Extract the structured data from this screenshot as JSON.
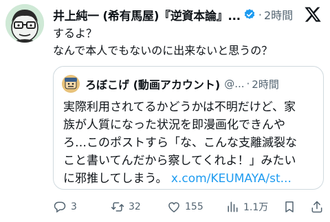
{
  "post": {
    "author_name": "井上純一 (希有馬屋)『逆資本論』...",
    "time": "2時間",
    "lines": [
      "するよ？",
      "なんで本人でもないのに出来ないと思うの？"
    ]
  },
  "quote": {
    "author_name": "ろぼこげ (動画アカウント)",
    "handle": "@...",
    "time": "2時間",
    "lines": [
      "実際利用されてるかどうかは不明だけど、家",
      "族が人質になった状況を即漫画化できんや",
      "ろ…このポストすら「な、こんな支離滅裂な",
      "こと書いてんだから察してくれよ！」みたい"
    ],
    "last_line": "に邪推してしまう。",
    "link": "x.com/KEUMAYA/st..."
  },
  "actions": {
    "replies": "3",
    "reposts": "32",
    "likes": "155",
    "views": "1.1万"
  },
  "colors": {
    "accent": "#1d9bf0",
    "muted": "#536471",
    "border": "#cfd9de"
  },
  "icons": [
    "verified-badge-icon",
    "x-logo-icon",
    "reply-icon",
    "repost-icon",
    "like-icon",
    "views-icon",
    "bookmark-icon",
    "share-icon"
  ]
}
